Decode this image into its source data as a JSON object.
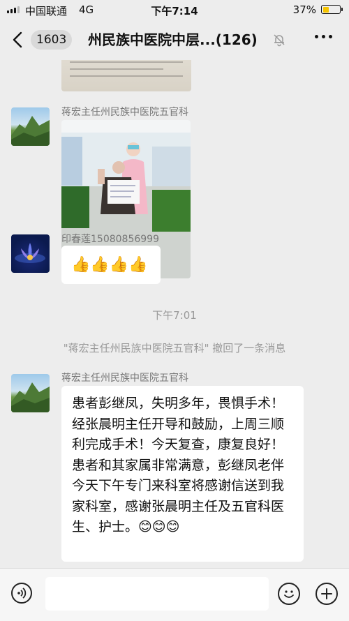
{
  "status_bar": {
    "carrier": "中国联通",
    "network": "4G",
    "time": "下午7:14",
    "battery_percent": "37%",
    "battery_level": 0.37
  },
  "nav": {
    "badge_count": "1603",
    "title": "州民族中医院中层...(126)"
  },
  "messages": [
    {
      "sender": "蒋宏主任州民族中医院五官科",
      "type": "image"
    },
    {
      "sender": "印春莲15080856999",
      "type": "emoji",
      "content": "👍👍👍👍"
    },
    {
      "type": "time",
      "text": "下午7:01"
    },
    {
      "type": "system",
      "text": "\"蒋宏主任州民族中医院五官科\" 撤回了一条消息"
    },
    {
      "sender": "蒋宏主任州民族中医院五官科",
      "type": "text",
      "text": "患者彭继凤，失明多年，畏惧手术！经张晨明主任开导和鼓励，上周三顺利完成手术！今天复查，康复良好！患者和其家属非常满意，彭继凤老伴今天下午专门来科室将感谢信送到我家科室，感谢张晨明主任及五官科医生、护士。😊😊😊"
    }
  ],
  "input_bar": {
    "icons": [
      "voice-icon",
      "emoji-icon",
      "plus-icon"
    ]
  },
  "colors": {
    "background": "#ededed",
    "bubble": "#ffffff",
    "battery": "#f5c400"
  }
}
